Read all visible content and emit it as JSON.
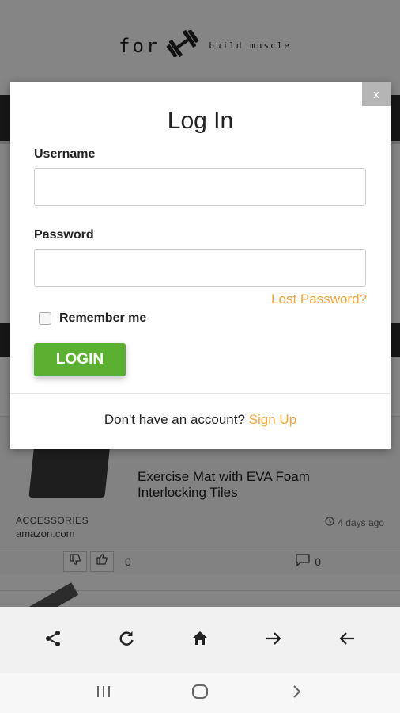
{
  "background": {
    "logo": {
      "word": "for",
      "tagline": "build muscle"
    },
    "card": {
      "title": "Exercise Mat with EVA Foam Interlocking Tiles",
      "category": "ACCESSORIES",
      "source": "amazon.com",
      "age": "4 days ago",
      "likes": "0",
      "comments": "0"
    }
  },
  "modal": {
    "close_label": "x",
    "title": "Log In",
    "username_label": "Username",
    "username_value": "",
    "password_label": "Password",
    "password_value": "",
    "lost_password": "Lost Password?",
    "remember_label": "Remember me",
    "login_button": "LOGIN",
    "signup_prompt": "Don't have an account?",
    "signup_link": "Sign Up"
  },
  "toolbar": {
    "icons": [
      "share-icon",
      "refresh-icon",
      "home-icon",
      "forward-arrow-icon",
      "back-arrow-icon"
    ]
  },
  "system_nav": {
    "icons": [
      "recent-apps-icon",
      "home-circle-icon",
      "back-chevron-icon"
    ]
  },
  "colors": {
    "accent": "#f0a640",
    "login": "#5bb031",
    "overlay": "#000000"
  }
}
